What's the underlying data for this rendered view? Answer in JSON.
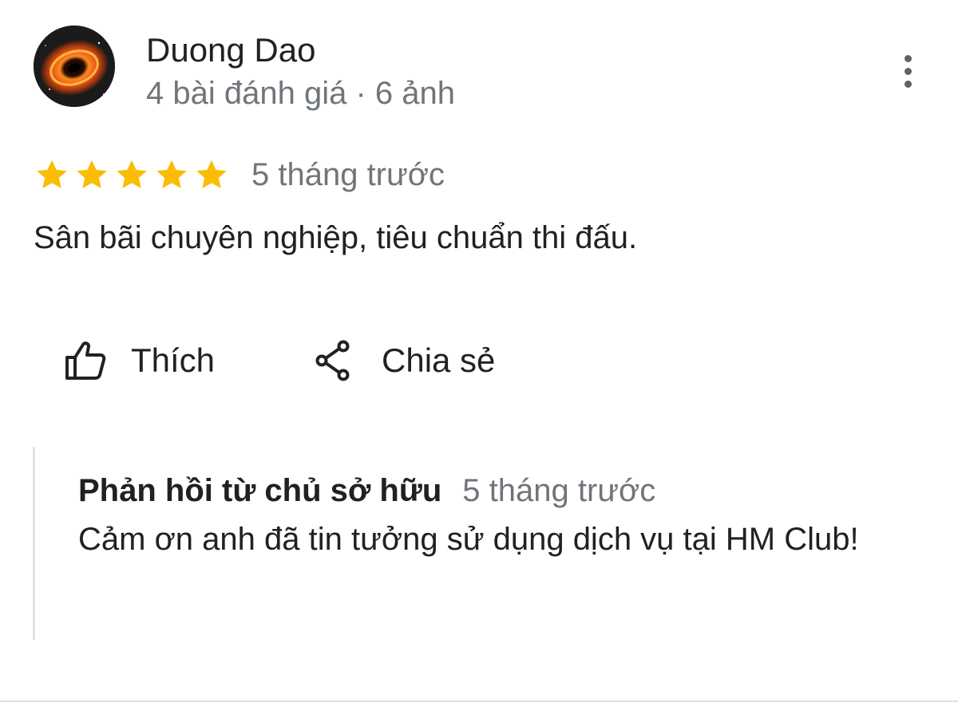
{
  "author": {
    "name": "Duong Dao",
    "meta": "4 bài đánh giá · 6 ảnh",
    "avatar_icon": "black-hole-avatar"
  },
  "review": {
    "rating": 5,
    "rating_max": 5,
    "time": "5 tháng trước",
    "text": "Sân bãi chuyên nghiệp, tiêu chuẩn thi đấu."
  },
  "actions": {
    "like_label": "Thích",
    "like_icon": "thumbs-up-icon",
    "share_label": "Chia sẻ",
    "share_icon": "share-icon",
    "more_icon": "more-vert-icon"
  },
  "owner_reply": {
    "title": "Phản hồi từ chủ sở hữu",
    "time": "5 tháng trước",
    "text": "Cảm ơn anh đã tin tưởng sử dụng dịch vụ tại HM Club!"
  },
  "colors": {
    "star": "#fbbc04",
    "secondary_text": "#70757a",
    "primary_text": "#202124",
    "reply_border": "#e2e2e2"
  }
}
